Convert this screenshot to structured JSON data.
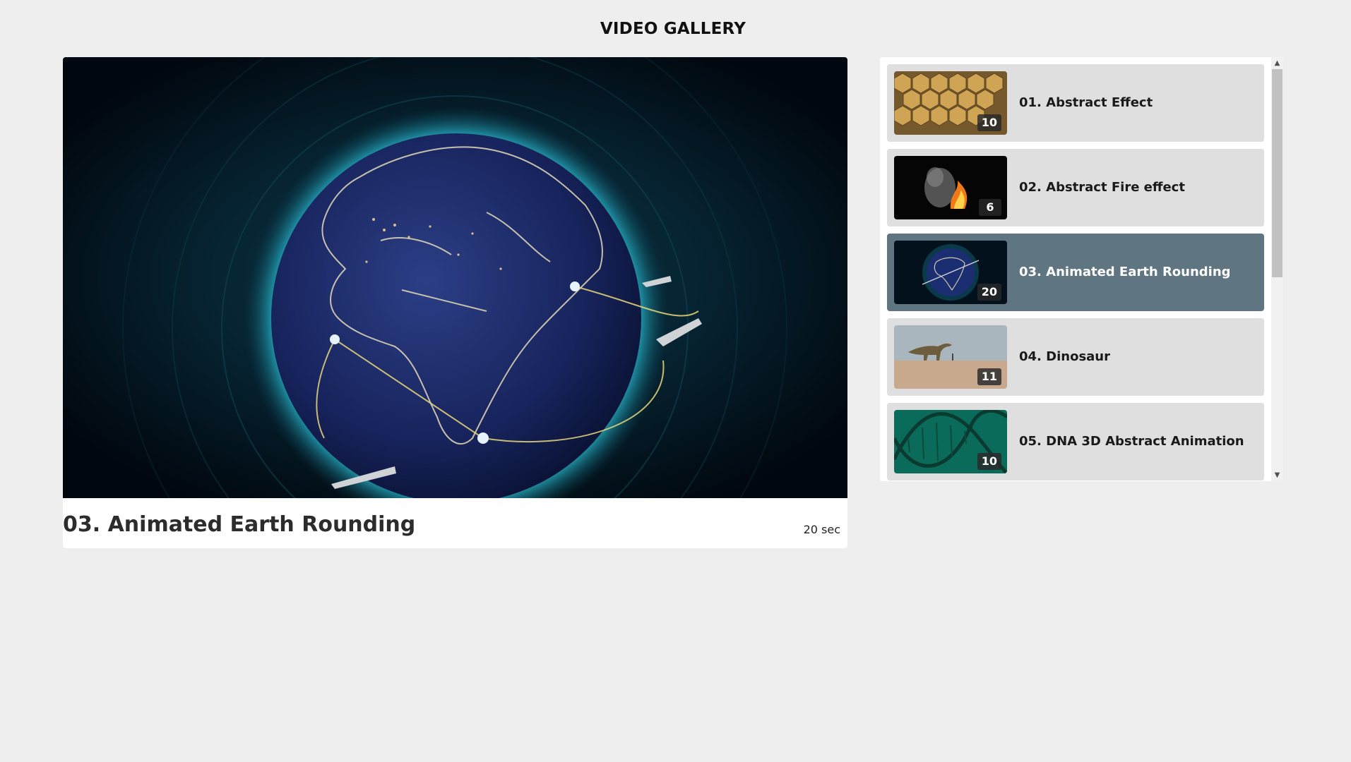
{
  "page": {
    "heading": "VIDEO GALLERY"
  },
  "player": {
    "title": "03. Animated Earth Rounding",
    "duration": "20 sec"
  },
  "playlist": {
    "items": [
      {
        "label": "01. Abstract Effect",
        "duration": "10",
        "thumb": "gold-hexagons-thumbnail",
        "active": false
      },
      {
        "label": "02. Abstract Fire effect",
        "duration": "6",
        "thumb": "fire-smoke-thumbnail",
        "active": false
      },
      {
        "label": "03. Animated Earth Rounding",
        "duration": "20",
        "thumb": "earth-globe-thumbnail",
        "active": true
      },
      {
        "label": "04. Dinosaur",
        "duration": "11",
        "thumb": "dinosaur-thumbnail",
        "active": false
      },
      {
        "label": "05. DNA 3D Abstract Animation",
        "duration": "10",
        "thumb": "dna-helix-thumbnail",
        "active": false
      }
    ]
  },
  "scrollbar": {
    "up_icon": "chevron-up-icon",
    "down_icon": "chevron-down-icon",
    "position": 0
  },
  "colors": {
    "page_background": "#eeeeee",
    "active_item": "#5f7581",
    "inactive_item": "#dfdfdf"
  }
}
